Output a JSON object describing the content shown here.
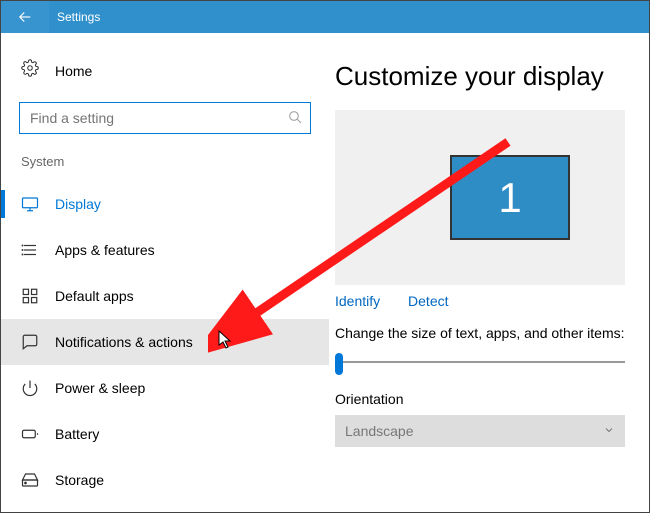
{
  "window_title": "Settings",
  "home_label": "Home",
  "search_placeholder": "Find a setting",
  "group_label": "System",
  "nav": [
    {
      "label": "Display"
    },
    {
      "label": "Apps & features"
    },
    {
      "label": "Default apps"
    },
    {
      "label": "Notifications & actions"
    },
    {
      "label": "Power & sleep"
    },
    {
      "label": "Battery"
    },
    {
      "label": "Storage"
    }
  ],
  "page_title": "Customize your display",
  "monitor_number": "1",
  "identify_label": "Identify",
  "detect_label": "Detect",
  "scale_text": "Change the size of text, apps, and other items:",
  "orientation_label": "Orientation",
  "orientation_value": "Landscape"
}
